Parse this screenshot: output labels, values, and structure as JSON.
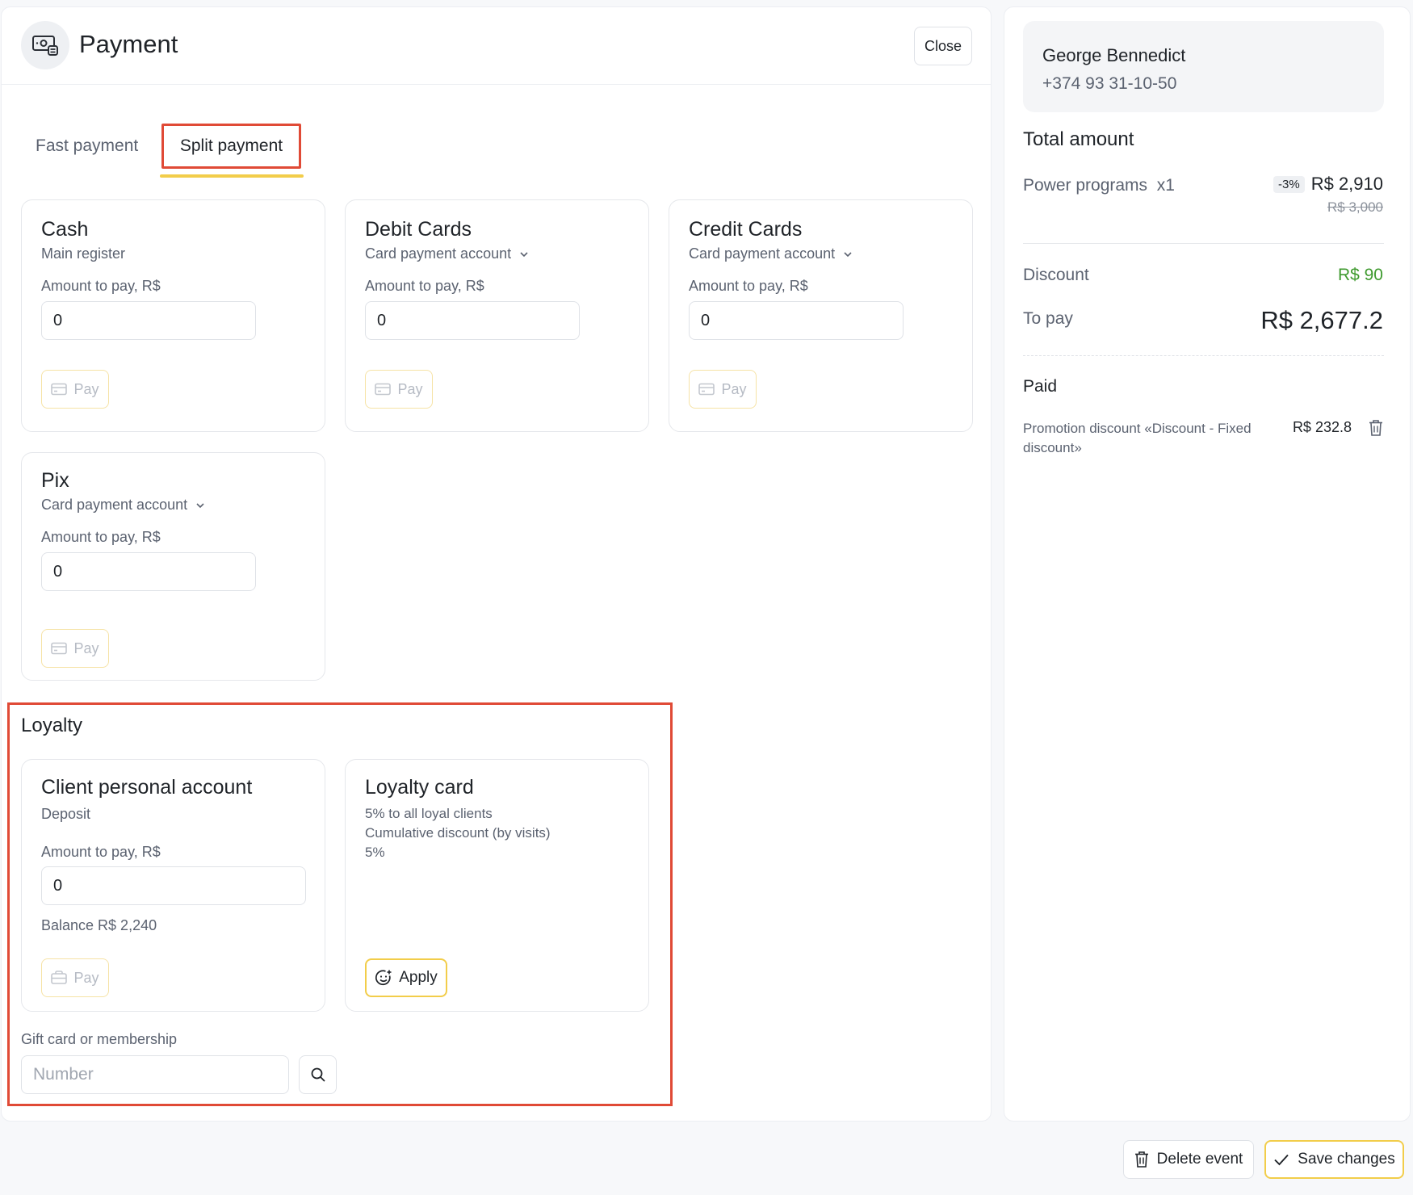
{
  "header": {
    "title": "Payment",
    "close_label": "Close"
  },
  "tabs": [
    {
      "label": "Fast payment",
      "active": false
    },
    {
      "label": "Split payment",
      "active": true
    }
  ],
  "methods": [
    {
      "title": "Cash",
      "subtitle": "Main register",
      "amount_label": "Amount to pay, R$",
      "amount": "0",
      "pay_label": "Pay"
    },
    {
      "title": "Debit Cards",
      "subtitle": "Card payment account",
      "amount_label": "Amount to pay, R$",
      "amount": "0",
      "pay_label": "Pay"
    },
    {
      "title": "Credit Cards",
      "subtitle": "Card payment account",
      "amount_label": "Amount to pay, R$",
      "amount": "0",
      "pay_label": "Pay"
    },
    {
      "title": "Pix",
      "subtitle": "Card payment account",
      "amount_label": "Amount to pay, R$",
      "amount": "0",
      "pay_label": "Pay"
    }
  ],
  "loyalty": {
    "title": "Loyalty",
    "personal_account": {
      "title": "Client personal account",
      "subtitle": "Deposit",
      "amount_label": "Amount to pay, R$",
      "amount": "0",
      "balance": "Balance R$ 2,240",
      "pay_label": "Pay"
    },
    "loyalty_card": {
      "title": "Loyalty card",
      "lines": [
        "5% to all loyal clients",
        "Cumulative discount (by visits)",
        "5%"
      ],
      "apply_label": "Apply"
    },
    "gift": {
      "label": "Gift card or membership",
      "placeholder": "Number"
    }
  },
  "summary": {
    "client_name": "George Bennedict",
    "client_phone": "+374 93 31-10-50",
    "total_title": "Total amount",
    "item_name": "Power programs  x1",
    "item_badge": "-3%",
    "item_price": "R$ 2,910",
    "item_old_price": "R$ 3,000",
    "discount_label": "Discount",
    "discount_value": "R$ 90",
    "to_pay_label": "To pay",
    "to_pay_value": "R$ 2,677.2",
    "paid_title": "Paid",
    "promo_label": "Promotion discount «Discount - Fixed discount»",
    "promo_value": "R$ 232.8"
  },
  "footer": {
    "delete_label": "Delete event",
    "save_label": "Save changes"
  },
  "colors": {
    "accent_yellow": "#f2cd4a",
    "highlight_red": "#e04a36",
    "discount_green": "#3f9a2f"
  }
}
